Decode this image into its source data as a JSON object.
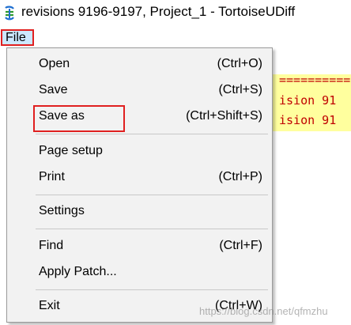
{
  "window": {
    "title": "revisions 9196-9197, Project_1 - TortoiseUDiff",
    "icon": "tortoise-diff-icon"
  },
  "menubar": {
    "file_label": "File"
  },
  "menu": {
    "items": [
      {
        "label": "Open",
        "shortcut": "(Ctrl+O)"
      },
      {
        "label": "Save",
        "shortcut": "(Ctrl+S)"
      },
      {
        "label": "Save as",
        "shortcut": "(Ctrl+Shift+S)"
      },
      {
        "label": "Page setup",
        "shortcut": ""
      },
      {
        "label": "Print",
        "shortcut": "(Ctrl+P)"
      },
      {
        "label": "Settings",
        "shortcut": ""
      },
      {
        "label": "Find",
        "shortcut": "(Ctrl+F)"
      },
      {
        "label": "Apply Patch...",
        "shortcut": ""
      },
      {
        "label": "Exit",
        "shortcut": "(Ctrl+W)"
      }
    ]
  },
  "editor": {
    "lines": [
      "==========",
      "ision 91",
      "ision 91"
    ]
  },
  "watermark": "https://blog.csdn.net/qfmzhu",
  "colors": {
    "highlight_border": "#e02020",
    "menu_selected_bg": "#cce8ff",
    "diff_bg": "#ffff9e",
    "diff_text": "#c00000"
  }
}
